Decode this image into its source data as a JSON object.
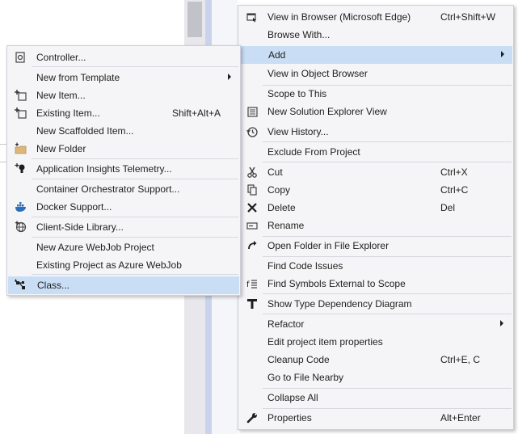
{
  "main_menu": {
    "items": [
      {
        "label": "View in Browser (Microsoft Edge)",
        "shortcut": "Ctrl+Shift+W",
        "icon": "browser-icon"
      },
      {
        "label": "Browse With...",
        "shortcut": "",
        "icon": ""
      },
      {
        "label": "Add",
        "shortcut": "",
        "icon": "",
        "submenu": true,
        "highlighted": true
      },
      {
        "label": "View in Object Browser",
        "shortcut": "",
        "icon": ""
      },
      {
        "label": "Scope to This",
        "shortcut": "",
        "icon": ""
      },
      {
        "label": "New Solution Explorer View",
        "shortcut": "",
        "icon": "solution-explorer-icon"
      },
      {
        "label": "View History...",
        "shortcut": "",
        "icon": "history-icon"
      },
      {
        "label": "Exclude From Project",
        "shortcut": "",
        "icon": ""
      },
      {
        "label": "Cut",
        "shortcut": "Ctrl+X",
        "icon": "scissors-icon"
      },
      {
        "label": "Copy",
        "shortcut": "Ctrl+C",
        "icon": "copy-icon"
      },
      {
        "label": "Delete",
        "shortcut": "Del",
        "icon": "delete-x-icon"
      },
      {
        "label": "Rename",
        "shortcut": "",
        "icon": "rename-icon"
      },
      {
        "label": "Open Folder in File Explorer",
        "shortcut": "",
        "icon": "refresh-arrow-icon"
      },
      {
        "label": "Find Code Issues",
        "shortcut": "",
        "icon": ""
      },
      {
        "label": "Find Symbols External to Scope",
        "shortcut": "",
        "icon": "find-symbols-icon"
      },
      {
        "label": "Show Type Dependency Diagram",
        "shortcut": "",
        "icon": "dependency-diagram-icon"
      },
      {
        "label": "Refactor",
        "shortcut": "",
        "icon": "",
        "submenu": true
      },
      {
        "label": "Edit project item properties",
        "shortcut": "",
        "icon": ""
      },
      {
        "label": "Cleanup Code",
        "shortcut": "Ctrl+E, C",
        "icon": ""
      },
      {
        "label": "Go to File Nearby",
        "shortcut": "",
        "icon": ""
      },
      {
        "label": "Collapse All",
        "shortcut": "",
        "icon": ""
      },
      {
        "label": "Properties",
        "shortcut": "Alt+Enter",
        "icon": "wrench-icon"
      }
    ]
  },
  "add_submenu": {
    "items": [
      {
        "label": "Controller...",
        "shortcut": "",
        "icon": "controller-icon"
      },
      {
        "label": "New from Template",
        "shortcut": "",
        "icon": "",
        "submenu": true
      },
      {
        "label": "New Item...",
        "shortcut": "",
        "icon": "new-item-icon"
      },
      {
        "label": "Existing Item...",
        "shortcut": "Shift+Alt+A",
        "icon": "existing-item-icon"
      },
      {
        "label": "New Scaffolded Item...",
        "shortcut": "",
        "icon": ""
      },
      {
        "label": "New Folder",
        "shortcut": "",
        "icon": "new-folder-icon"
      },
      {
        "label": "Application Insights Telemetry...",
        "shortcut": "",
        "icon": "insights-icon"
      },
      {
        "label": "Container Orchestrator Support...",
        "shortcut": "",
        "icon": ""
      },
      {
        "label": "Docker Support...",
        "shortcut": "",
        "icon": "docker-icon"
      },
      {
        "label": "Client-Side Library...",
        "shortcut": "",
        "icon": "globe-icon"
      },
      {
        "label": "New Azure WebJob Project",
        "shortcut": "",
        "icon": ""
      },
      {
        "label": "Existing Project as Azure WebJob",
        "shortcut": "",
        "icon": ""
      },
      {
        "label": "Class...",
        "shortcut": "",
        "icon": "class-icon",
        "highlighted": true
      }
    ]
  },
  "colors": {
    "menu_bg": "#f5f5f7",
    "highlight": "#c9def5",
    "border": "#cccedb",
    "separator": "#d7d8df",
    "text": "#1e1e1e"
  }
}
